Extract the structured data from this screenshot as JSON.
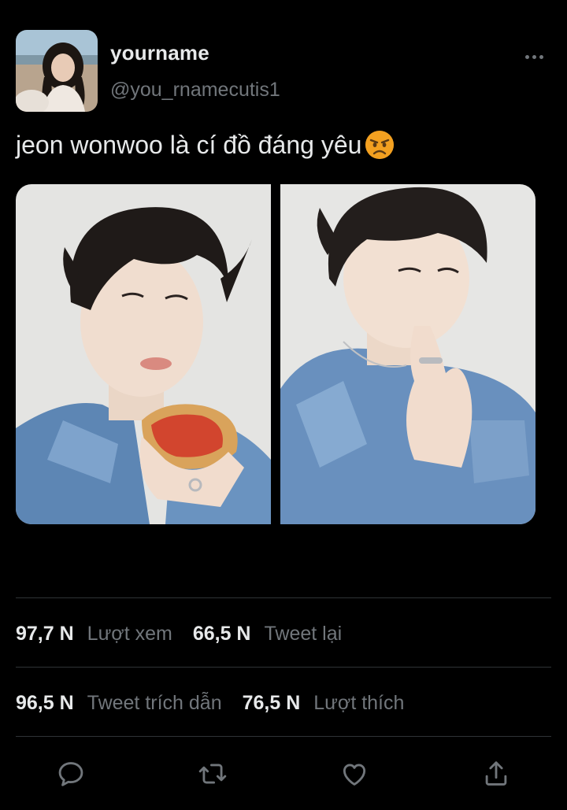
{
  "author": {
    "display_name": "yourname",
    "handle": "@you_rnamecutis1"
  },
  "tweet": {
    "text": "jeon wonwoo là cí đồ đáng yêu",
    "emoji": "angry-face-emoji",
    "media_count": 2
  },
  "stats": {
    "views": {
      "value": "97,7 N",
      "label": "Lượt xem"
    },
    "retweets": {
      "value": "66,5 N",
      "label": "Tweet lại"
    },
    "quotes": {
      "value": "96,5 N",
      "label": "Tweet trích dẫn"
    },
    "likes": {
      "value": "76,5 N",
      "label": "Lượt thích"
    }
  },
  "actions": [
    "reply-icon",
    "retweet-icon",
    "like-icon",
    "share-icon"
  ],
  "colors": {
    "background": "#000000",
    "text_primary": "#e7e9ea",
    "text_secondary": "#71767b",
    "divider": "#2f3336"
  }
}
